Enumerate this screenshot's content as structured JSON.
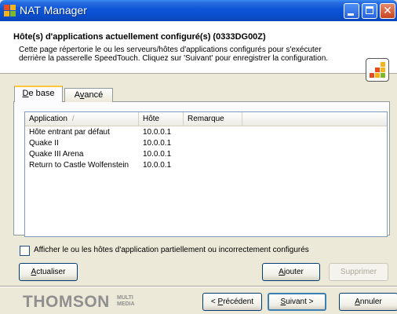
{
  "window": {
    "title": "NAT Manager",
    "icon": "nat-manager-icon",
    "controls": [
      "minimize-icon",
      "maximize-icon",
      "close-icon"
    ]
  },
  "header": {
    "title": "Hôte(s) d'applications actuellement configuré(s) (0333DG00Z)",
    "description": "Cette page répertorie le ou les serveurs/hôtes d'applications configurés pour s'exécuter derrière la passerelle SpeedTouch. Cliquez sur 'Suivant' pour enregistrer la configuration.",
    "logo": "speedtouch-logo-icon"
  },
  "tabs": [
    {
      "label": "De base",
      "mnemonic": "D",
      "rest": "e base",
      "selected": true
    },
    {
      "label": "Avancé",
      "prefix": "A",
      "mnemonic": "v",
      "rest": "ancé",
      "selected": false
    }
  ],
  "list": {
    "columns": [
      "Application",
      "Hôte",
      "Remarque"
    ],
    "sort_indicator": "/",
    "rows": [
      {
        "application": "Hôte entrant par défaut",
        "host": "10.0.0.1",
        "note": ""
      },
      {
        "application": "Quake II",
        "host": "10.0.0.1",
        "note": ""
      },
      {
        "application": "Quake III Arena",
        "host": "10.0.0.1",
        "note": ""
      },
      {
        "application": "Return to Castle Wolfenstein",
        "host": "10.0.0.1",
        "note": ""
      }
    ]
  },
  "checkbox": {
    "label": "Afficher le ou les hôtes d'application partiellement ou incorrectement configurés",
    "checked": false
  },
  "buttons": {
    "refresh": {
      "mnemonic": "A",
      "rest": "ctualiser"
    },
    "add": {
      "mnemonic": "A",
      "rest": "jouter"
    },
    "remove": {
      "label": "Supprimer",
      "enabled": false
    },
    "prev": {
      "prefix": "< ",
      "mnemonic": "P",
      "rest": "récédent"
    },
    "next": {
      "mnemonic": "S",
      "rest": "uivant >"
    },
    "cancel": {
      "mnemonic": "A",
      "rest": "nnuler"
    }
  },
  "brand": {
    "name": "THOMSON",
    "sub_line1": "MULTI",
    "sub_line2": "MEDIA"
  },
  "colors": {
    "titlebar": "#0a4fcf",
    "dialog_bg": "#ece9d8",
    "tab_highlight": "#ffc83c",
    "disabled_text": "#aca899"
  }
}
